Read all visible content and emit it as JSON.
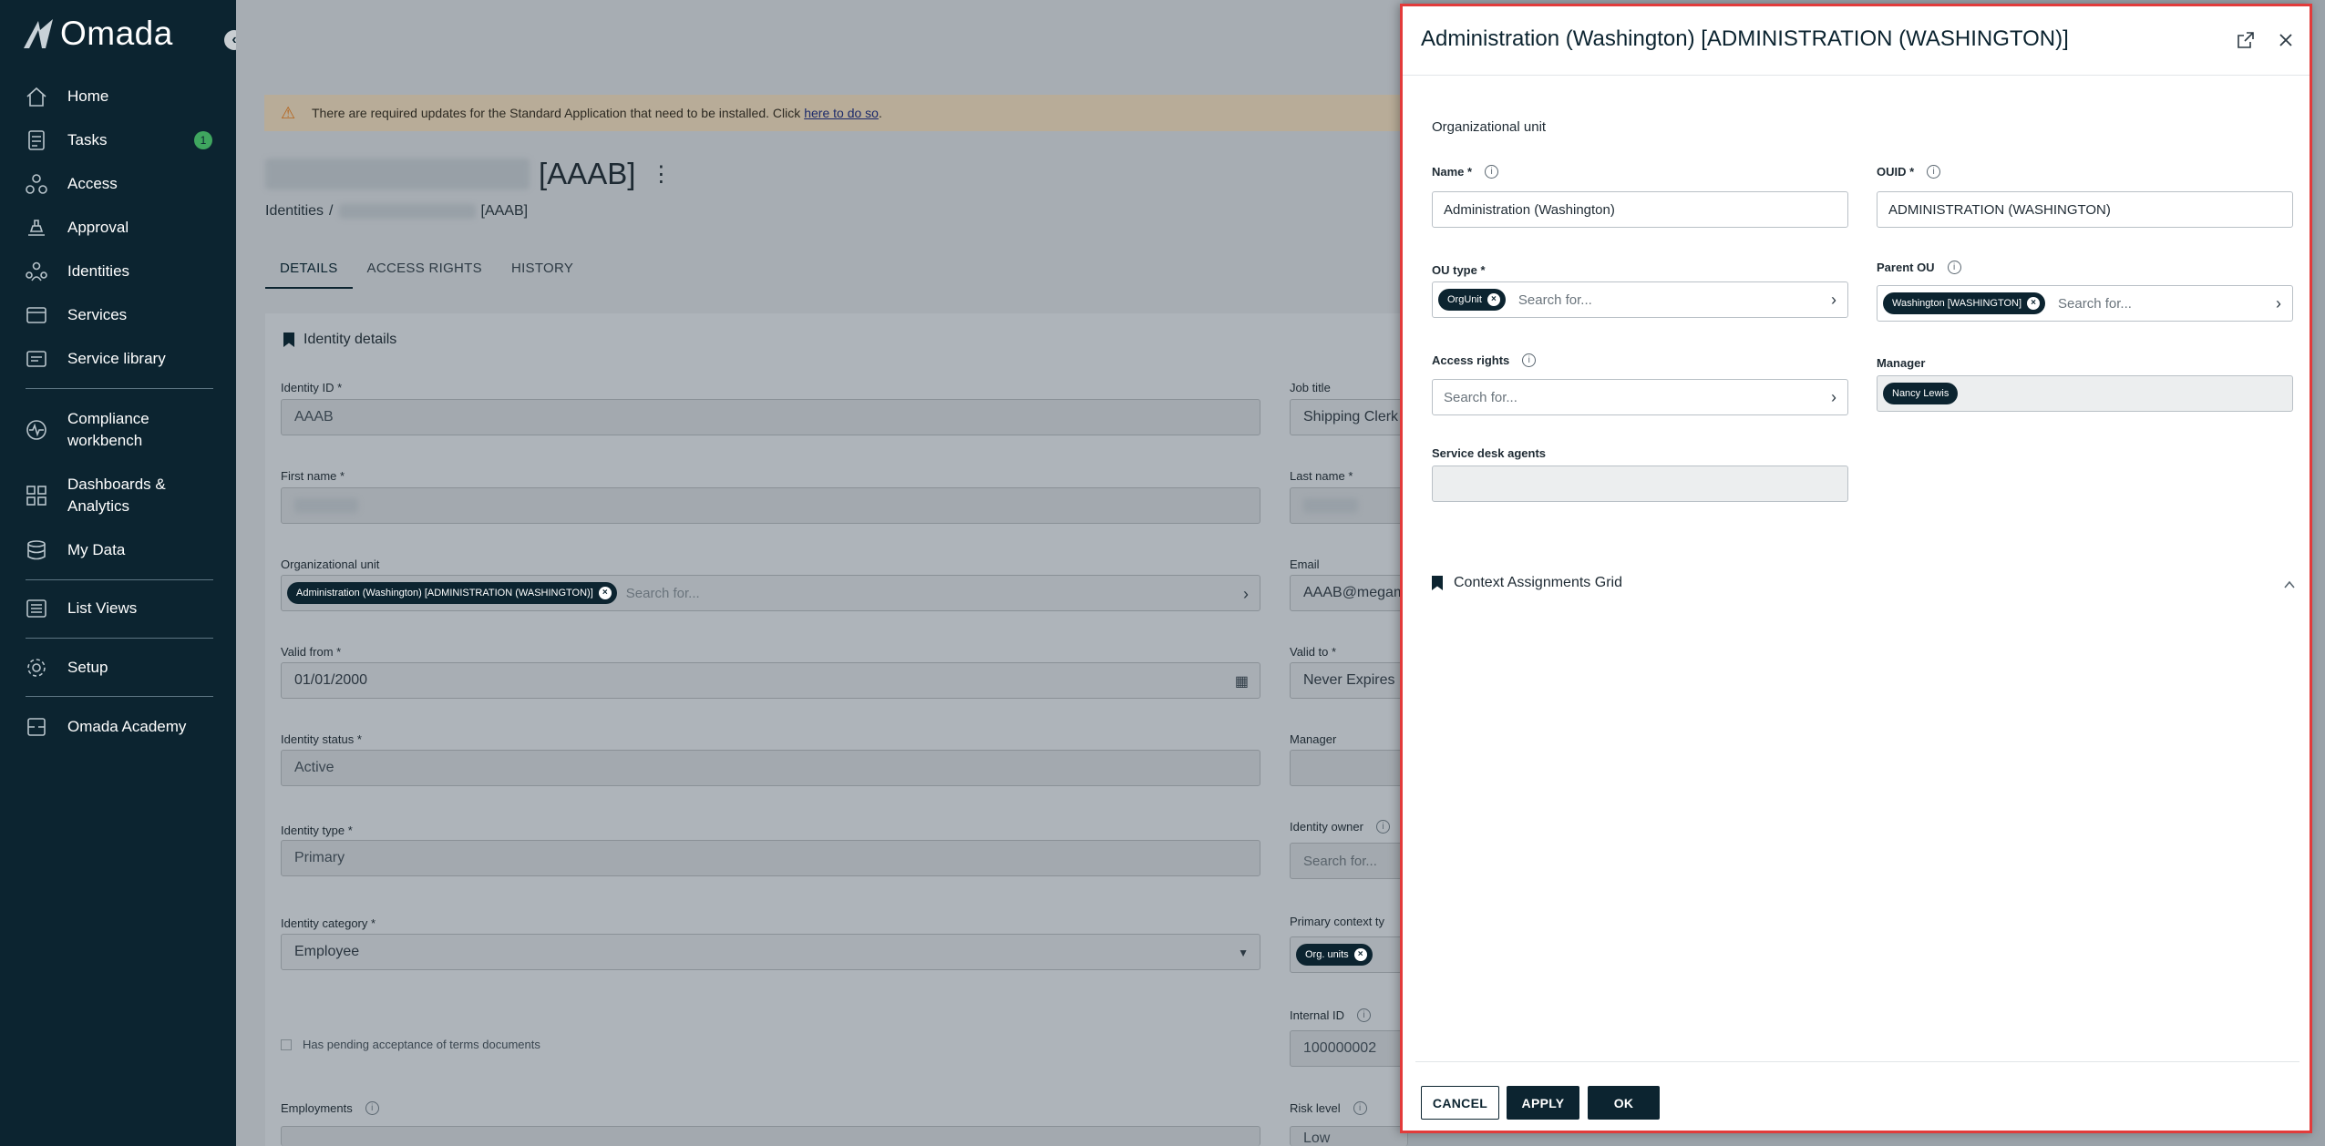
{
  "sidebar": {
    "logo": "Omada",
    "collapse_glyph": "‹",
    "items": [
      {
        "label": "Home",
        "icon": "home-icon"
      },
      {
        "label": "Tasks",
        "icon": "tasks-icon",
        "badge": "1"
      },
      {
        "label": "Access",
        "icon": "access-icon"
      },
      {
        "label": "Approval",
        "icon": "approval-icon"
      },
      {
        "label": "Identities",
        "icon": "identities-icon"
      },
      {
        "label": "Services",
        "icon": "services-icon"
      },
      {
        "label": "Service library",
        "icon": "service-library-icon"
      },
      {
        "label": "Compliance workbench",
        "icon": "compliance-icon"
      },
      {
        "label": "Dashboards & Analytics",
        "icon": "dashboards-icon"
      },
      {
        "label": "My Data",
        "icon": "my-data-icon"
      },
      {
        "label": "List Views",
        "icon": "list-views-icon"
      },
      {
        "label": "Setup",
        "icon": "setup-icon"
      },
      {
        "label": "Omada Academy",
        "icon": "academy-icon"
      }
    ]
  },
  "main": {
    "warning_text": "There are required updates for the Standard Application that need to be installed. Click",
    "warning_link": "here to do so",
    "warning_end": ".",
    "identity_suffix": "[AAAB]",
    "breadcrumb_root": "Identities",
    "breadcrumb_sep": "/",
    "breadcrumb_suffix": "[AAAB]",
    "tabs": [
      "DETAILS",
      "ACCESS RIGHTS",
      "HISTORY"
    ],
    "section_title": "Identity details",
    "fields": {
      "identity_id_label": "Identity ID *",
      "identity_id_value": "AAAB",
      "first_name_label": "First name *",
      "org_unit_label": "Organizational unit",
      "org_unit_chip": "Administration (Washington) [ADMINISTRATION (WASHINGTON)]",
      "search_placeholder": "Search for...",
      "valid_from_label": "Valid from *",
      "valid_from_value": "01/01/2000",
      "identity_status_label": "Identity status *",
      "identity_status_value": "Active",
      "identity_type_label": "Identity type *",
      "identity_type_value": "Primary",
      "identity_category_label": "Identity category *",
      "identity_category_value": "Employee",
      "pending_terms_label": "Has pending acceptance of terms documents",
      "employments_label": "Employments",
      "job_title_label": "Job title",
      "job_title_value": "Shipping Clerk",
      "last_name_label": "Last name *",
      "email_label": "Email",
      "email_value": "AAAB@megam",
      "valid_to_label": "Valid to *",
      "valid_to_value": "Never Expires",
      "manager_label": "Manager",
      "identity_owner_label": "Identity owner",
      "identity_owner_ph": "Search for...",
      "primary_context_label": "Primary context ty",
      "primary_context_chip": "Org. units",
      "internal_id_label": "Internal ID",
      "internal_id_value": "100000002",
      "risk_level_label": "Risk level",
      "risk_level_value": "Low"
    }
  },
  "dialog": {
    "title": "Administration (Washington) [ADMINISTRATION (WASHINGTON)]",
    "subtitle": "Organizational unit",
    "name_label": "Name *",
    "name_value": "Administration (Washington)",
    "ouid_label": "OUID *",
    "ouid_value": "ADMINISTRATION (WASHINGTON)",
    "ou_type_label": "OU type *",
    "ou_type_chip": "OrgUnit",
    "parent_ou_label": "Parent OU",
    "parent_ou_chip": "Washington [WASHINGTON]",
    "access_rights_label": "Access rights",
    "manager_label": "Manager",
    "manager_chip": "Nancy Lewis",
    "service_desk_label": "Service desk agents",
    "search_placeholder": "Search for...",
    "context_grid_label": "Context Assignments Grid",
    "buttons": {
      "cancel": "CANCEL",
      "apply": "APPLY",
      "ok": "OK"
    }
  },
  "colors": {
    "accent": "#0c2430",
    "badge": "#3fa65f",
    "highlight_border": "#e23b3b"
  }
}
